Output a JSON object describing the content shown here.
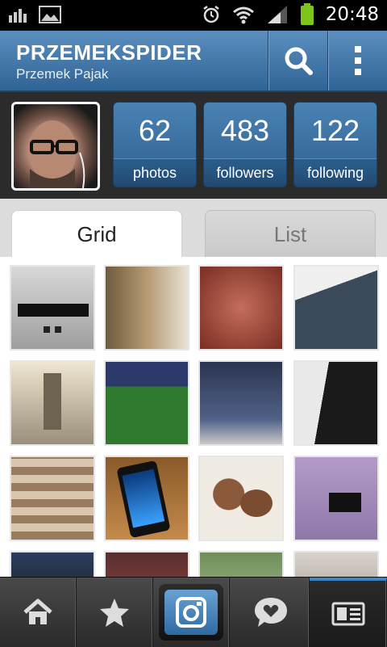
{
  "status_bar": {
    "time": "20:48",
    "icons": [
      "signal-bars-icon",
      "image-icon",
      "alarm-icon",
      "wifi-icon",
      "cell-signal-icon",
      "battery-icon"
    ]
  },
  "header": {
    "username": "PRZEMEKSPIDER",
    "full_name": "Przemek Pajak",
    "actions": [
      "search-icon",
      "overflow-menu-icon"
    ]
  },
  "profile": {
    "stats": [
      {
        "value": "62",
        "label": "photos"
      },
      {
        "value": "483",
        "label": "followers"
      },
      {
        "value": "122",
        "label": "following"
      }
    ]
  },
  "tabs": [
    {
      "label": "Grid",
      "active": true
    },
    {
      "label": "List",
      "active": false
    }
  ],
  "photos": [
    {
      "subject": "LED display on wall"
    },
    {
      "subject": "Statue"
    },
    {
      "subject": "Map detail"
    },
    {
      "subject": "Glass building"
    },
    {
      "subject": "Tower under construction"
    },
    {
      "subject": "Football match on TV"
    },
    {
      "subject": "Laptop screen"
    },
    {
      "subject": "Building sign"
    },
    {
      "subject": "Checkered chair"
    },
    {
      "subject": "Smartphone"
    },
    {
      "subject": "Food on plate"
    },
    {
      "subject": "TV on purple wall"
    }
  ],
  "bottom_nav": [
    {
      "icon": "home-icon",
      "active": false
    },
    {
      "icon": "star-icon",
      "active": false
    },
    {
      "icon": "camera-icon",
      "active": false
    },
    {
      "icon": "heart-bubble-icon",
      "active": false
    },
    {
      "icon": "profile-card-icon",
      "active": true
    }
  ]
}
